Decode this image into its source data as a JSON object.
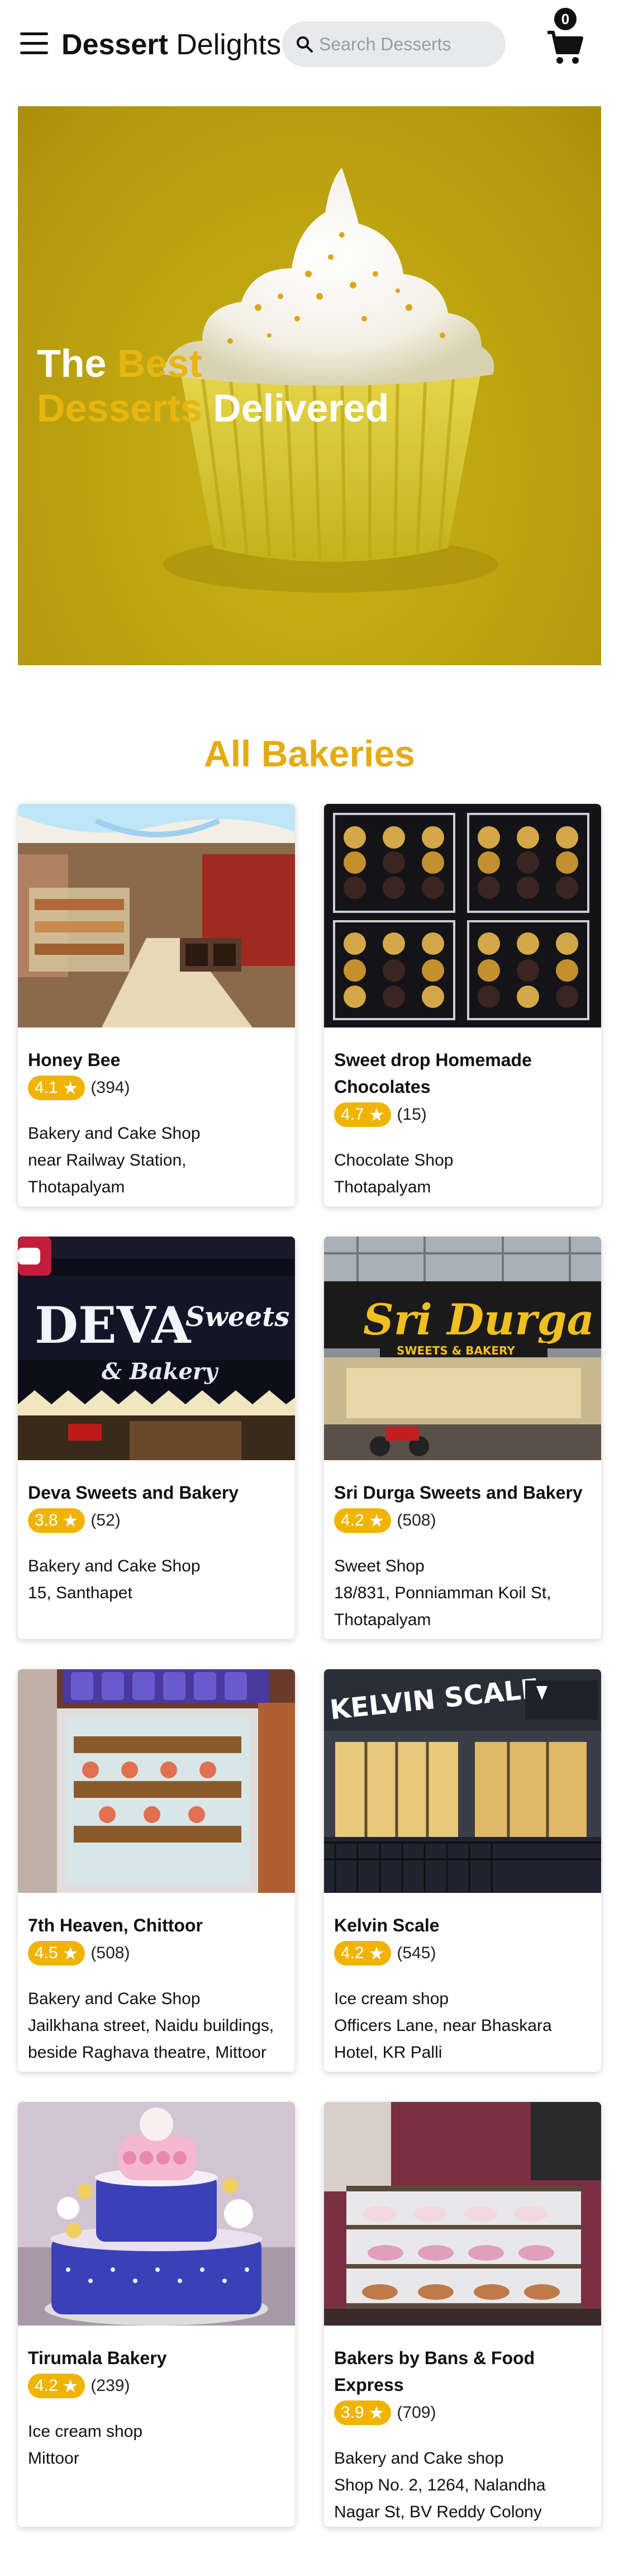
{
  "header": {
    "brand_bold": "Dessert",
    "brand_rest": " Delights",
    "search_placeholder": "Search Desserts",
    "cart_count": "0",
    "icons": [
      "menu-icon",
      "search-icon",
      "cart-icon"
    ]
  },
  "hero": {
    "line1_white": "The ",
    "line1_accent": "Best",
    "line2_accent": "Desserts",
    "line2_white": " Delivered"
  },
  "section": {
    "title": "All Bakeries"
  },
  "colors": {
    "accent": "#e4ac12",
    "rating": "#f0b400",
    "hero_bg": "#c0a712"
  },
  "bakeries": [
    {
      "name": "Honey Bee",
      "rating": "4.1",
      "count": "(394)",
      "category": "Bakery and Cake Shop",
      "address": [
        "near Railway Station,",
        "Thotapalyam"
      ]
    },
    {
      "name": "Sweet drop Homemade Chocolates",
      "rating": "4.7",
      "count": "(15)",
      "category": "Chocolate Shop",
      "address": [
        "Thotapalyam"
      ]
    },
    {
      "name": "Deva Sweets and Bakery",
      "rating": "3.8",
      "count": "(52)",
      "category": "Bakery and Cake Shop",
      "address": [
        "15, Santhapet"
      ],
      "sign_text": "DEVA",
      "sign_sub": "Sweets",
      "sign_sub2": "& Bakery"
    },
    {
      "name": "Sri Durga Sweets and Bakery",
      "rating": "4.2",
      "count": "(508)",
      "category": "Sweet Shop",
      "address": [
        "18/831, Ponniamman Koil St,",
        "Thotapalyam"
      ],
      "sign_text": "Sri Durga",
      "sign_sub": "SWEETS & BAKERY"
    },
    {
      "name": "7th Heaven, Chittoor",
      "rating": "4.5",
      "count": "(508)",
      "category": "Bakery and Cake Shop",
      "address": [
        "Jailkhana street, Naidu buildings,",
        "beside Raghava theatre, Mittoor"
      ]
    },
    {
      "name": "Kelvin Scale",
      "rating": "4.2",
      "count": "(545)",
      "category": "Ice cream shop",
      "address": [
        "Officers Lane, near Bhaskara",
        "Hotel, KR Palli"
      ],
      "sign_text": "KELVIN SCALE"
    },
    {
      "name": "Tirumala Bakery",
      "rating": "4.2",
      "count": "(239)",
      "category": "Ice cream shop",
      "address": [
        "Mittoor"
      ]
    },
    {
      "name": "Bakers by Bans & Food Express",
      "rating": "3.9",
      "count": "(709)",
      "category": "Bakery and Cake shop",
      "address": [
        "Shop No. 2, 1264, Nalandha",
        "Nagar St, BV Reddy Colony"
      ]
    }
  ]
}
